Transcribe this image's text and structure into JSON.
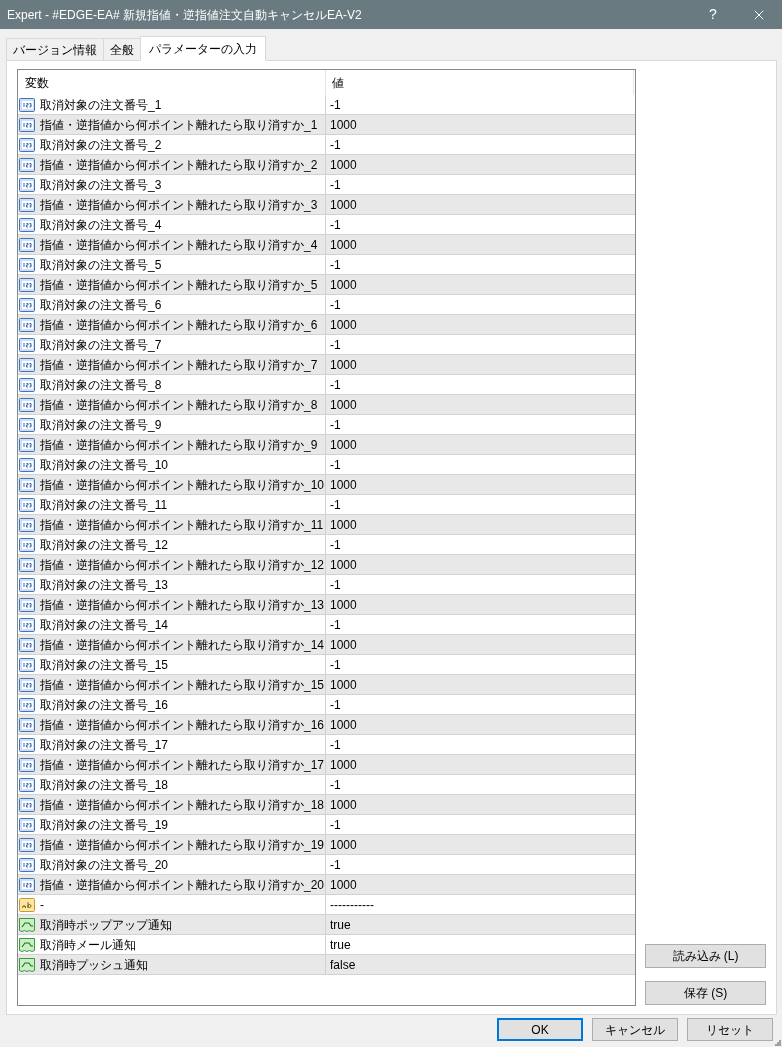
{
  "window": {
    "title": "Expert - #EDGE-EA# 新規指値・逆指値注文自動キャンセルEA-V2",
    "help": "?"
  },
  "tabs": [
    {
      "label": "バージョン情報",
      "selected": false
    },
    {
      "label": "全般",
      "selected": false
    },
    {
      "label": "パラメーターの入力",
      "selected": true
    }
  ],
  "table": {
    "columns": [
      "変数",
      "値"
    ],
    "rows": [
      {
        "kind": "number",
        "name": "取消対象の注文番号_1",
        "value": "-1"
      },
      {
        "kind": "number",
        "name": "指値・逆指値から何ポイント離れたら取り消すか_1",
        "value": "1000"
      },
      {
        "kind": "number",
        "name": "取消対象の注文番号_2",
        "value": "-1"
      },
      {
        "kind": "number",
        "name": "指値・逆指値から何ポイント離れたら取り消すか_2",
        "value": "1000"
      },
      {
        "kind": "number",
        "name": "取消対象の注文番号_3",
        "value": "-1"
      },
      {
        "kind": "number",
        "name": "指値・逆指値から何ポイント離れたら取り消すか_3",
        "value": "1000"
      },
      {
        "kind": "number",
        "name": "取消対象の注文番号_4",
        "value": "-1"
      },
      {
        "kind": "number",
        "name": "指値・逆指値から何ポイント離れたら取り消すか_4",
        "value": "1000"
      },
      {
        "kind": "number",
        "name": "取消対象の注文番号_5",
        "value": "-1"
      },
      {
        "kind": "number",
        "name": "指値・逆指値から何ポイント離れたら取り消すか_5",
        "value": "1000"
      },
      {
        "kind": "number",
        "name": "取消対象の注文番号_6",
        "value": "-1"
      },
      {
        "kind": "number",
        "name": "指値・逆指値から何ポイント離れたら取り消すか_6",
        "value": "1000"
      },
      {
        "kind": "number",
        "name": "取消対象の注文番号_7",
        "value": "-1"
      },
      {
        "kind": "number",
        "name": "指値・逆指値から何ポイント離れたら取り消すか_7",
        "value": "1000"
      },
      {
        "kind": "number",
        "name": "取消対象の注文番号_8",
        "value": "-1"
      },
      {
        "kind": "number",
        "name": "指値・逆指値から何ポイント離れたら取り消すか_8",
        "value": "1000"
      },
      {
        "kind": "number",
        "name": "取消対象の注文番号_9",
        "value": "-1"
      },
      {
        "kind": "number",
        "name": "指値・逆指値から何ポイント離れたら取り消すか_9",
        "value": "1000"
      },
      {
        "kind": "number",
        "name": "取消対象の注文番号_10",
        "value": "-1"
      },
      {
        "kind": "number",
        "name": "指値・逆指値から何ポイント離れたら取り消すか_10",
        "value": "1000"
      },
      {
        "kind": "number",
        "name": "取消対象の注文番号_11",
        "value": "-1"
      },
      {
        "kind": "number",
        "name": "指値・逆指値から何ポイント離れたら取り消すか_11",
        "value": "1000"
      },
      {
        "kind": "number",
        "name": "取消対象の注文番号_12",
        "value": "-1"
      },
      {
        "kind": "number",
        "name": "指値・逆指値から何ポイント離れたら取り消すか_12",
        "value": "1000"
      },
      {
        "kind": "number",
        "name": "取消対象の注文番号_13",
        "value": "-1"
      },
      {
        "kind": "number",
        "name": "指値・逆指値から何ポイント離れたら取り消すか_13",
        "value": "1000"
      },
      {
        "kind": "number",
        "name": "取消対象の注文番号_14",
        "value": "-1"
      },
      {
        "kind": "number",
        "name": "指値・逆指値から何ポイント離れたら取り消すか_14",
        "value": "1000"
      },
      {
        "kind": "number",
        "name": "取消対象の注文番号_15",
        "value": "-1"
      },
      {
        "kind": "number",
        "name": "指値・逆指値から何ポイント離れたら取り消すか_15",
        "value": "1000"
      },
      {
        "kind": "number",
        "name": "取消対象の注文番号_16",
        "value": "-1"
      },
      {
        "kind": "number",
        "name": "指値・逆指値から何ポイント離れたら取り消すか_16",
        "value": "1000"
      },
      {
        "kind": "number",
        "name": "取消対象の注文番号_17",
        "value": "-1"
      },
      {
        "kind": "number",
        "name": "指値・逆指値から何ポイント離れたら取り消すか_17",
        "value": "1000"
      },
      {
        "kind": "number",
        "name": "取消対象の注文番号_18",
        "value": "-1"
      },
      {
        "kind": "number",
        "name": "指値・逆指値から何ポイント離れたら取り消すか_18",
        "value": "1000"
      },
      {
        "kind": "number",
        "name": "取消対象の注文番号_19",
        "value": "-1"
      },
      {
        "kind": "number",
        "name": "指値・逆指値から何ポイント離れたら取り消すか_19",
        "value": "1000"
      },
      {
        "kind": "number",
        "name": "取消対象の注文番号_20",
        "value": "-1"
      },
      {
        "kind": "number",
        "name": "指値・逆指値から何ポイント離れたら取り消すか_20",
        "value": "1000"
      },
      {
        "kind": "text",
        "name": "-",
        "value": "-----------"
      },
      {
        "kind": "bool",
        "name": "取消時ポップアップ通知",
        "value": "true"
      },
      {
        "kind": "bool",
        "name": "取消時メール通知",
        "value": "true"
      },
      {
        "kind": "bool",
        "name": "取消時プッシュ通知",
        "value": "false"
      }
    ]
  },
  "side_buttons": [
    "読み込み (L)",
    "保存 (S)"
  ],
  "footer_buttons": [
    {
      "label": "OK",
      "focused": true
    },
    {
      "label": "キャンセル",
      "focused": false
    },
    {
      "label": "リセット",
      "focused": false
    }
  ]
}
